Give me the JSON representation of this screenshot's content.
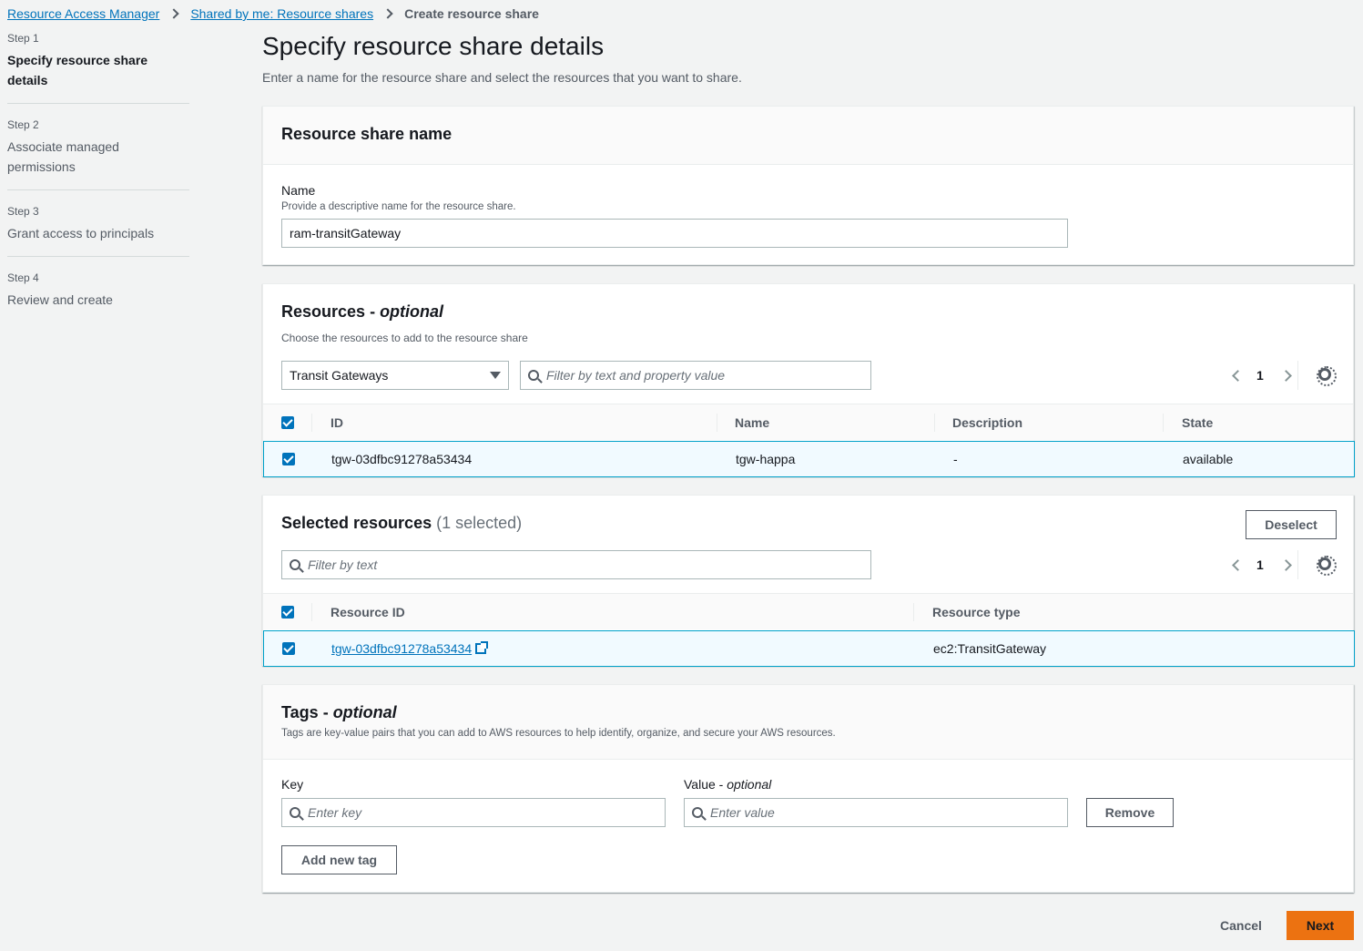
{
  "breadcrumb": {
    "item1": "Resource Access Manager",
    "item2": "Shared by me: Resource shares",
    "current": "Create resource share"
  },
  "steps": [
    {
      "num": "Step 1",
      "label": "Specify resource share details"
    },
    {
      "num": "Step 2",
      "label": "Associate managed permissions"
    },
    {
      "num": "Step 3",
      "label": "Grant access to principals"
    },
    {
      "num": "Step 4",
      "label": "Review and create"
    }
  ],
  "page": {
    "title": "Specify resource share details",
    "subtitle": "Enter a name for the resource share and select the resources that you want to share."
  },
  "share_name": {
    "heading": "Resource share name",
    "label": "Name",
    "hint": "Provide a descriptive name for the resource share.",
    "value": "ram-transitGateway"
  },
  "resources": {
    "heading": "Resources",
    "heading_suffix": "optional",
    "description": "Choose the resources to add to the resource share",
    "type_select": "Transit Gateways",
    "filter_placeholder": "Filter by text and property value",
    "page": "1",
    "columns": [
      "ID",
      "Name",
      "Description",
      "State"
    ],
    "rows": [
      {
        "id": "tgw-03dfbc91278a53434",
        "name": "tgw-happa",
        "description": "-",
        "state": "available"
      }
    ]
  },
  "selected": {
    "heading": "Selected resources",
    "count": "(1 selected)",
    "deselect_label": "Deselect",
    "filter_placeholder": "Filter by text",
    "page": "1",
    "columns": [
      "Resource ID",
      "Resource type"
    ],
    "rows": [
      {
        "id": "tgw-03dfbc91278a53434",
        "type": "ec2:TransitGateway"
      }
    ]
  },
  "tags": {
    "heading": "Tags",
    "heading_suffix": "optional",
    "description": "Tags are key-value pairs that you can add to AWS resources to help identify, organize, and secure your AWS resources.",
    "key_label": "Key",
    "value_label": "Value",
    "value_label_suffix": "optional",
    "key_placeholder": "Enter key",
    "value_placeholder": "Enter value",
    "remove_label": "Remove",
    "add_label": "Add new tag"
  },
  "footer": {
    "cancel_label": "Cancel",
    "next_label": "Next"
  },
  "colors": {
    "primary": "#ec7211",
    "link": "#0073bb",
    "selected_row": "#f1faff"
  }
}
